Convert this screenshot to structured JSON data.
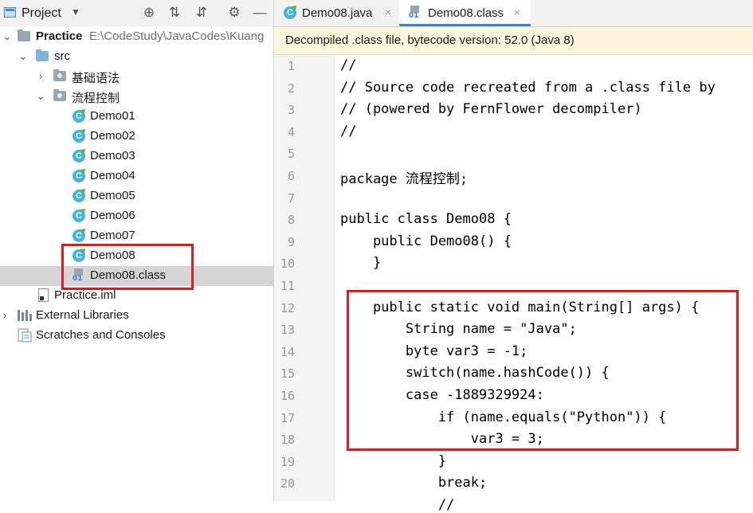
{
  "project_panel": {
    "title": "Project",
    "toolbar_icons": [
      "locate-icon",
      "expand-all-icon",
      "collapse-all-icon",
      "gear-icon",
      "minimize-icon"
    ]
  },
  "tree": {
    "root_name": "Practice",
    "root_path": "E:\\CodeStudy\\JavaCodes\\Kuang",
    "src": "src",
    "pkg1": "基础语法",
    "pkg2": "流程控制",
    "files": [
      "Demo01",
      "Demo02",
      "Demo03",
      "Demo04",
      "Demo05",
      "Demo06",
      "Demo07",
      "Demo08"
    ],
    "class_file": "Demo08.class",
    "class_badge": "01",
    "class_icon_letter": "C",
    "iml": "Practice.iml",
    "external_libraries": "External Libraries",
    "scratches": "Scratches and Consoles"
  },
  "editor": {
    "tabs": [
      {
        "label": "Demo08.java",
        "icon": "java-class-icon"
      },
      {
        "label": "Demo08.class",
        "icon": "class-file-icon"
      }
    ],
    "close_glyph": "×",
    "banner": "Decompiled .class file, bytecode version: 52.0 (Java 8)",
    "line_numbers": [
      "1",
      "2",
      "3",
      "4",
      "5",
      "6",
      "7",
      "8",
      "9",
      "10",
      "11",
      "12",
      "13",
      "14",
      "15",
      "16",
      "17",
      "18",
      "19",
      "20"
    ],
    "lines": [
      "//",
      "// Source code recreated from a .class file by",
      "// (powered by FernFlower decompiler)",
      "//",
      "",
      "package 流程控制;",
      "",
      "public class Demo08 {",
      "    public Demo08() {",
      "    }",
      "",
      "    public static void main(String[] args) {",
      "        String name = \"Java\";",
      "        byte var3 = -1;",
      "        switch(name.hashCode()) {",
      "        case -1889329924:",
      "            if (name.equals(\"Python\")) {",
      "                var3 = 3;",
      "            }",
      "            break;"
    ],
    "partial_line": "            //"
  }
}
